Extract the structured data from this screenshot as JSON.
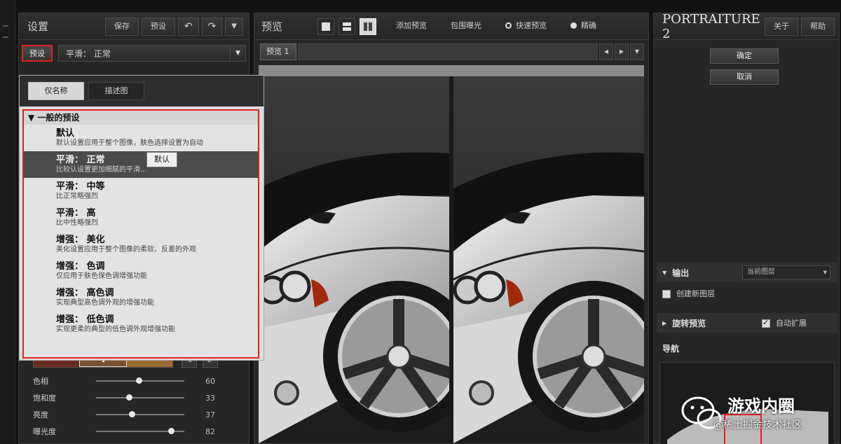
{
  "left_panel": {
    "title": "设置",
    "buttons": {
      "save": "保存",
      "preset": "预设",
      "undo": "↶",
      "redo": "↷",
      "menu": "▼"
    },
    "preset_tab": "预设",
    "preset_select": "平滑： 正常",
    "popup": {
      "tabs": [
        {
          "label": "仅名称"
        },
        {
          "label": "描述图"
        }
      ],
      "group_title": "一般的预设",
      "items": [
        {
          "name": "默认",
          "desc": "默认设置应用于整个图像，肤色选择设置为自动"
        },
        {
          "name": "平滑： 正常",
          "desc": "比较认设置更加细腻的平滑..."
        },
        {
          "name": "平滑： 中等",
          "desc": "比正常略强烈"
        },
        {
          "name": "平滑： 高",
          "desc": "比中性略强烈"
        },
        {
          "name": "增强： 美化",
          "desc": "美化设置应用于整个图像的柔软、反差的外观"
        },
        {
          "name": "增强： 色调",
          "desc": "仅应用于肤色保色调增强功能"
        },
        {
          "name": "增强： 高色调",
          "desc": "实现典型高色调外观的增强功能"
        },
        {
          "name": "增强： 低色调",
          "desc": "实现更柔的典型的低色调外观增强功能"
        }
      ],
      "tooltip": "默认"
    },
    "sliders": [
      {
        "label": "色相",
        "value": "60",
        "pos": 0.45
      },
      {
        "label": "饱和度",
        "value": "33",
        "pos": 0.34
      },
      {
        "label": "亮度",
        "value": "37",
        "pos": 0.37
      },
      {
        "label": "曝光度",
        "value": "82",
        "pos": 0.82
      }
    ]
  },
  "center_panel": {
    "title": "预览",
    "buttons": {
      "before_after": "添加预览",
      "mask": "包围曝光",
      "quick_preview": "快速预览",
      "fine": "精确"
    },
    "tab": "预览 1"
  },
  "right_panel": {
    "title": "PORTRAITURE 2",
    "about": "关于",
    "help": "帮助",
    "ok": "确定",
    "cancel": "取消",
    "output": {
      "label": "输出",
      "select": "当前图层"
    },
    "new_layer": "创建新图层",
    "batch": {
      "label": "旋转预览",
      "auto": "自动扩展"
    },
    "nav": "导航"
  },
  "watermark": {
    "brand": "游戏内圈",
    "sub": "@稀土掘金技术社区"
  },
  "colors": {
    "accent_red": "#e02020",
    "panel_bg": "#262626"
  }
}
